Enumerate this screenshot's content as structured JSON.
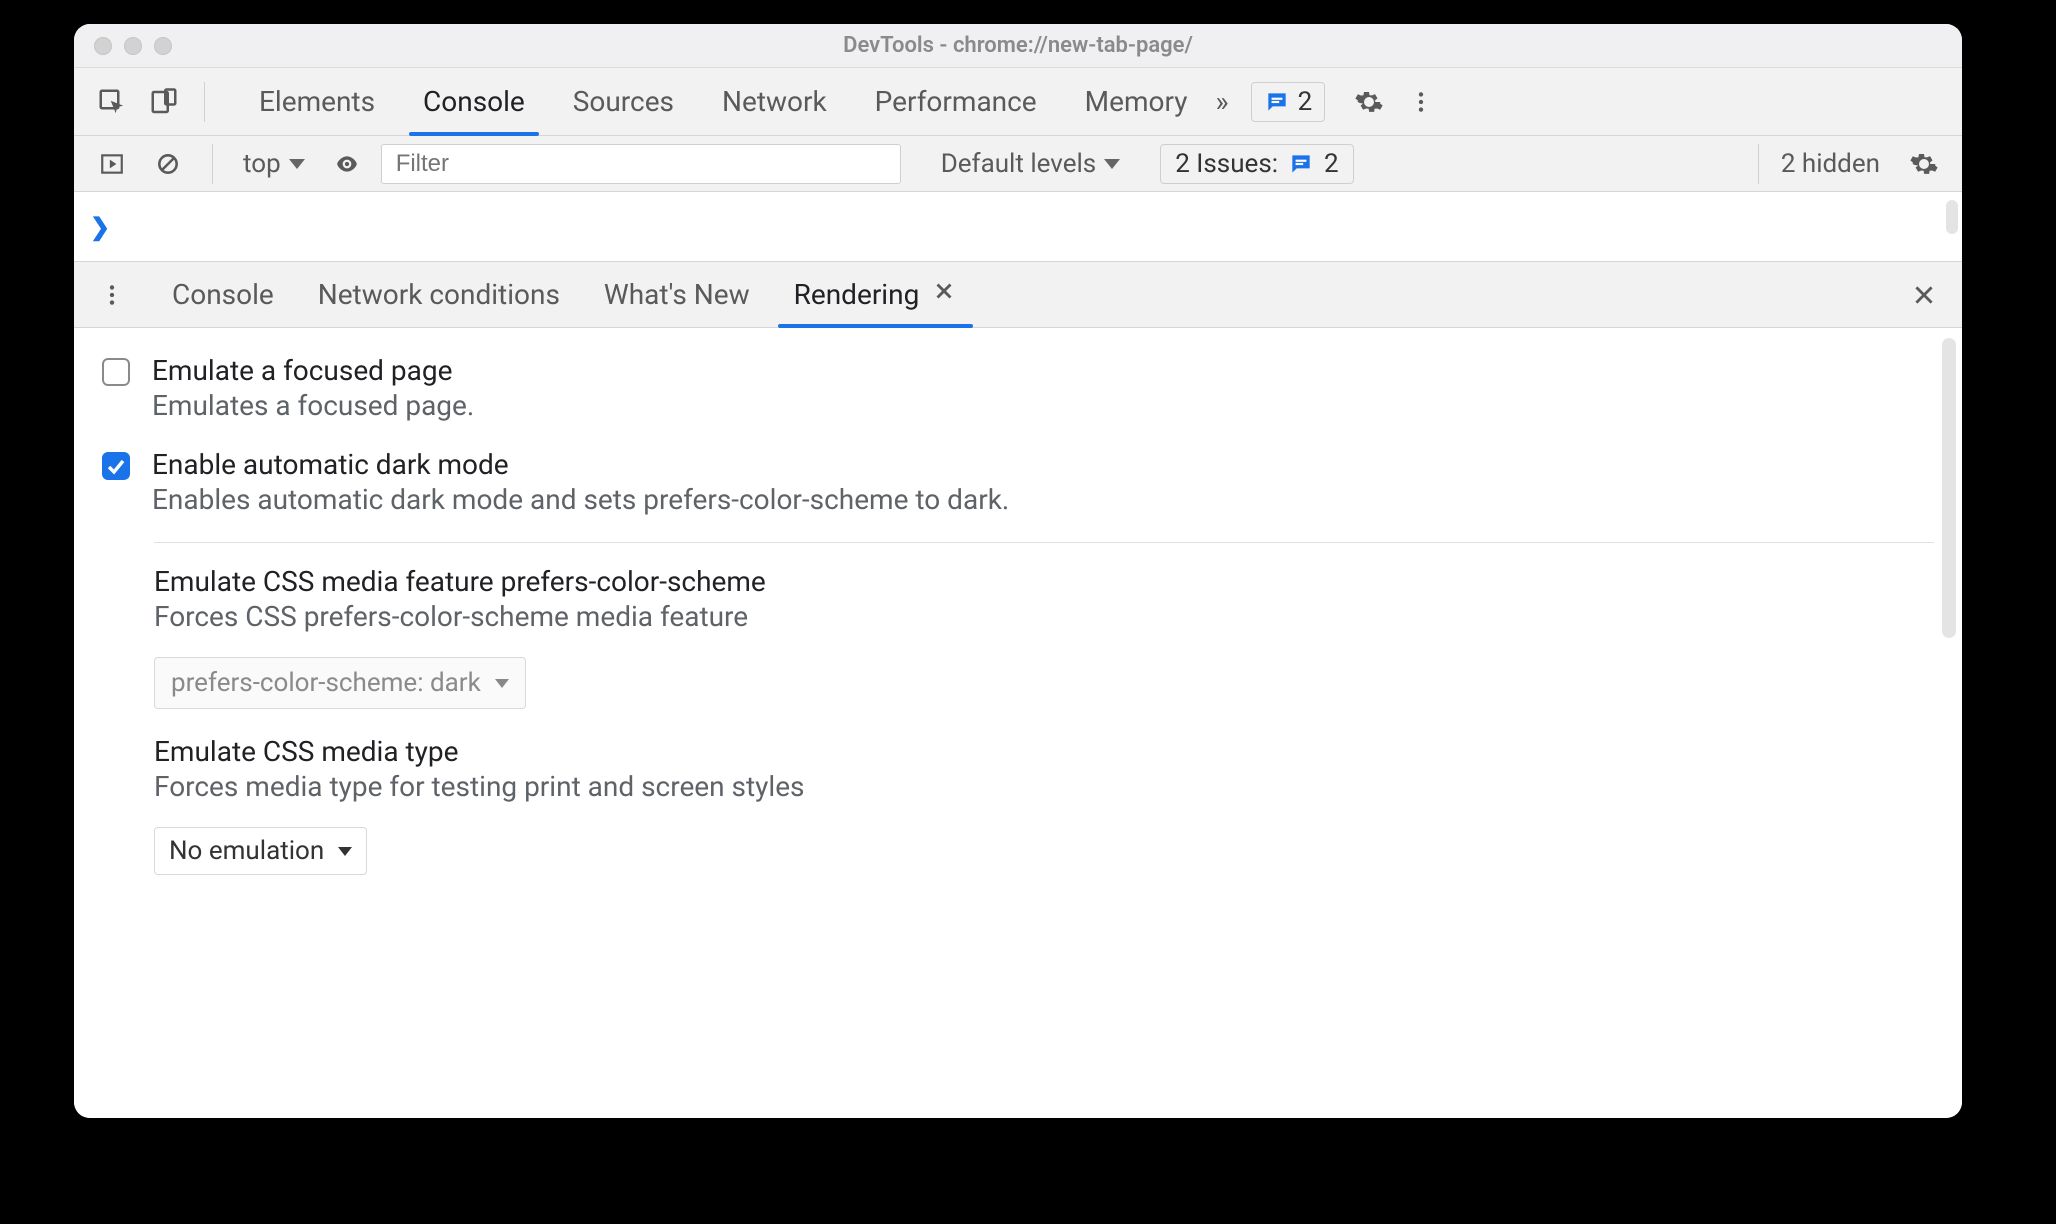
{
  "window": {
    "title": "DevTools - chrome://new-tab-page/"
  },
  "mainTabs": {
    "items": [
      "Elements",
      "Console",
      "Sources",
      "Network",
      "Performance",
      "Memory"
    ],
    "activeIndex": 1,
    "moreCount": "»",
    "messagesBadge": "2"
  },
  "consoleToolbar": {
    "context": "top",
    "filterPlaceholder": "Filter",
    "levelsLabel": "Default levels",
    "issuesLabel": "2 Issues:",
    "issuesCount": "2",
    "hiddenLabel": "2 hidden"
  },
  "drawer": {
    "tabs": [
      "Console",
      "Network conditions",
      "What's New",
      "Rendering"
    ],
    "activeIndex": 3
  },
  "rendering": {
    "focus": {
      "title": "Emulate a focused page",
      "desc": "Emulates a focused page.",
      "checked": false
    },
    "darkmode": {
      "title": "Enable automatic dark mode",
      "desc": "Enables automatic dark mode and sets prefers-color-scheme to dark.",
      "checked": true
    },
    "prefersColor": {
      "title": "Emulate CSS media feature prefers-color-scheme",
      "desc": "Forces CSS prefers-color-scheme media feature",
      "value": "prefers-color-scheme: dark"
    },
    "mediaType": {
      "title": "Emulate CSS media type",
      "desc": "Forces media type for testing print and screen styles",
      "value": "No emulation"
    }
  }
}
